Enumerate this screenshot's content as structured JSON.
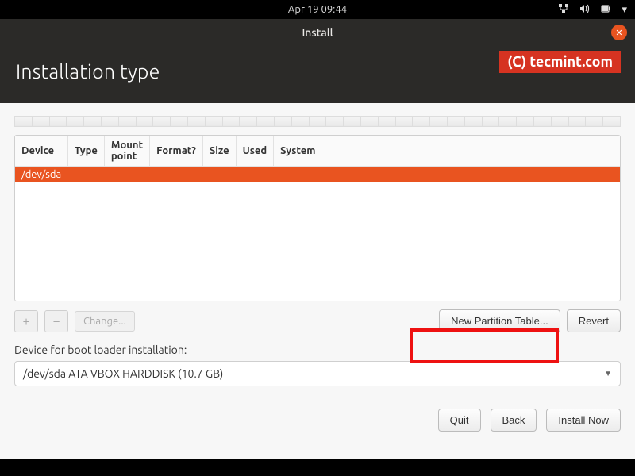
{
  "topbar": {
    "datetime": "Apr 19  09:44"
  },
  "window": {
    "title": "Install"
  },
  "watermark": "(C) tecmint.com",
  "page_title": "Installation type",
  "table": {
    "headers": [
      "Device",
      "Type",
      "Mount point",
      "Format?",
      "Size",
      "Used",
      "System"
    ],
    "rows": [
      {
        "device": "/dev/sda",
        "type": "",
        "mount": "",
        "format": "",
        "size": "",
        "used": "",
        "system": ""
      }
    ]
  },
  "toolbar": {
    "add": "+",
    "remove": "−",
    "change": "Change...",
    "new_partition_table": "New Partition Table...",
    "revert": "Revert"
  },
  "bootloader": {
    "label": "Device for boot loader installation:",
    "value": "/dev/sda ATA VBOX HARDDISK (10.7 GB)"
  },
  "footer": {
    "quit": "Quit",
    "back": "Back",
    "install": "Install Now"
  }
}
